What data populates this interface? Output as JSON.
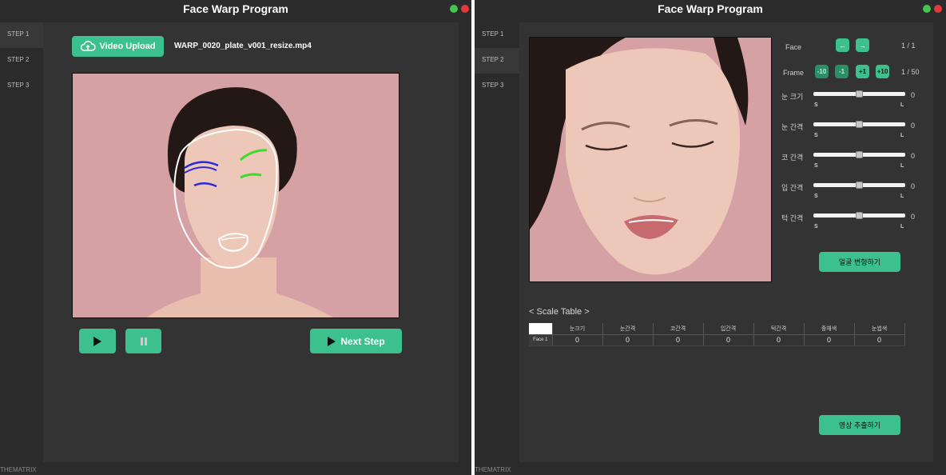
{
  "app_title": "Face Warp Program",
  "footer_brand": "THEMATRIX",
  "steps": [
    "STEP 1",
    "STEP 2",
    "STEP 3"
  ],
  "left": {
    "upload_label": "Video Upload",
    "filename": "WARP_0020_plate_v001_resize.mp4",
    "play_icon": "play-icon",
    "pause_icon": "pause-icon",
    "next_label": "Next Step"
  },
  "right": {
    "face_label": "Face",
    "face_count": "1 / 1",
    "frame_label": "Frame",
    "frame_buttons": [
      "-10",
      "-1",
      "+1",
      "+10"
    ],
    "frame_count": "1 / 50",
    "sliders": [
      {
        "label": "눈 크기",
        "value": "0",
        "min": "S",
        "max": "L",
        "level": 0.5
      },
      {
        "label": "눈 간격",
        "value": "0",
        "min": "S",
        "max": "L",
        "level": 0.5
      },
      {
        "label": "코 간격",
        "value": "0",
        "min": "S",
        "max": "L",
        "level": 0.5
      },
      {
        "label": "입 간격",
        "value": "0",
        "min": "S",
        "max": "L",
        "level": 0.5
      },
      {
        "label": "턱 간격",
        "value": "0",
        "min": "S",
        "max": "L",
        "level": 0.5
      }
    ],
    "transform_label": "얼굴 변형하기",
    "scale_table_title": "< Scale Table >",
    "table_headers": [
      "눈크기",
      "눈간격",
      "코간격",
      "입간격",
      "턱간격",
      "중채색",
      "눈썹색"
    ],
    "table_rows": [
      {
        "name": "Face 1",
        "values": [
          "0",
          "0",
          "0",
          "0",
          "0",
          "0",
          "0"
        ]
      }
    ],
    "export_label": "영상 추출하기"
  },
  "colors": {
    "accent": "#3cc08d",
    "background": "#2b2b2b",
    "panel": "#333333",
    "photo_bg": "#d5a1a5",
    "landmark_brow_left": "#2a2ad8",
    "landmark_brow_right": "#3cdc2a"
  }
}
